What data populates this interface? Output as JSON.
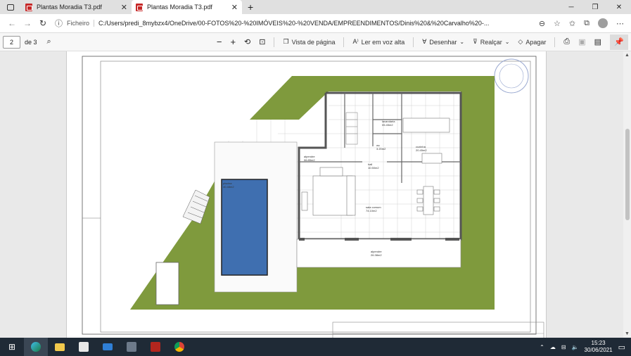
{
  "tabs": [
    {
      "title": "Plantas Moradia T3.pdf",
      "active": false
    },
    {
      "title": "Plantas Moradia T3.pdf",
      "active": true
    }
  ],
  "new_tab": "+",
  "window_controls": {
    "minimize": "─",
    "maximize": "❐",
    "close": "✕"
  },
  "address": {
    "label": "Ficheiro",
    "url": "C:/Users/predi_8mybzx4/OneDrive/00-FOTOS%20-%20IMÓVEIS%20-%20VENDA/EMPREENDIMENTOS/Dinis%20&%20Carvalho%20-..."
  },
  "pdf_toolbar": {
    "page": "2",
    "of": "de 3",
    "page_view": "Vista de página",
    "read_aloud": "Ler em voz alta",
    "draw": "Desenhar",
    "highlight": "Realçar",
    "erase": "Apagar"
  },
  "plan_labels": {
    "lavandaria": "lavandaria",
    "lavandaria_area": "05.45m2",
    "wc": "wc",
    "wc_area": "3.20m2",
    "cozinha": "cozinha",
    "cozinha_area": "20.45m2",
    "alpendre1": "alpendre",
    "alpendre1_area": "06.85m2",
    "hall": "hall",
    "hall_area": "10.50m2",
    "piscina": "piscina",
    "piscina_area": "40.48m2",
    "sala": "sala comum",
    "sala_area": "74.10m2",
    "alpendre2": "alpendre",
    "alpendre2_area": "26.38m2"
  },
  "taskbar": {
    "time": "15:23",
    "date": "30/06/2021"
  },
  "colors": {
    "grass": "#7f9a3d",
    "pool": "#3f6fb0",
    "taskbar": "#1f2a36",
    "pdf_red": "#c62828"
  }
}
